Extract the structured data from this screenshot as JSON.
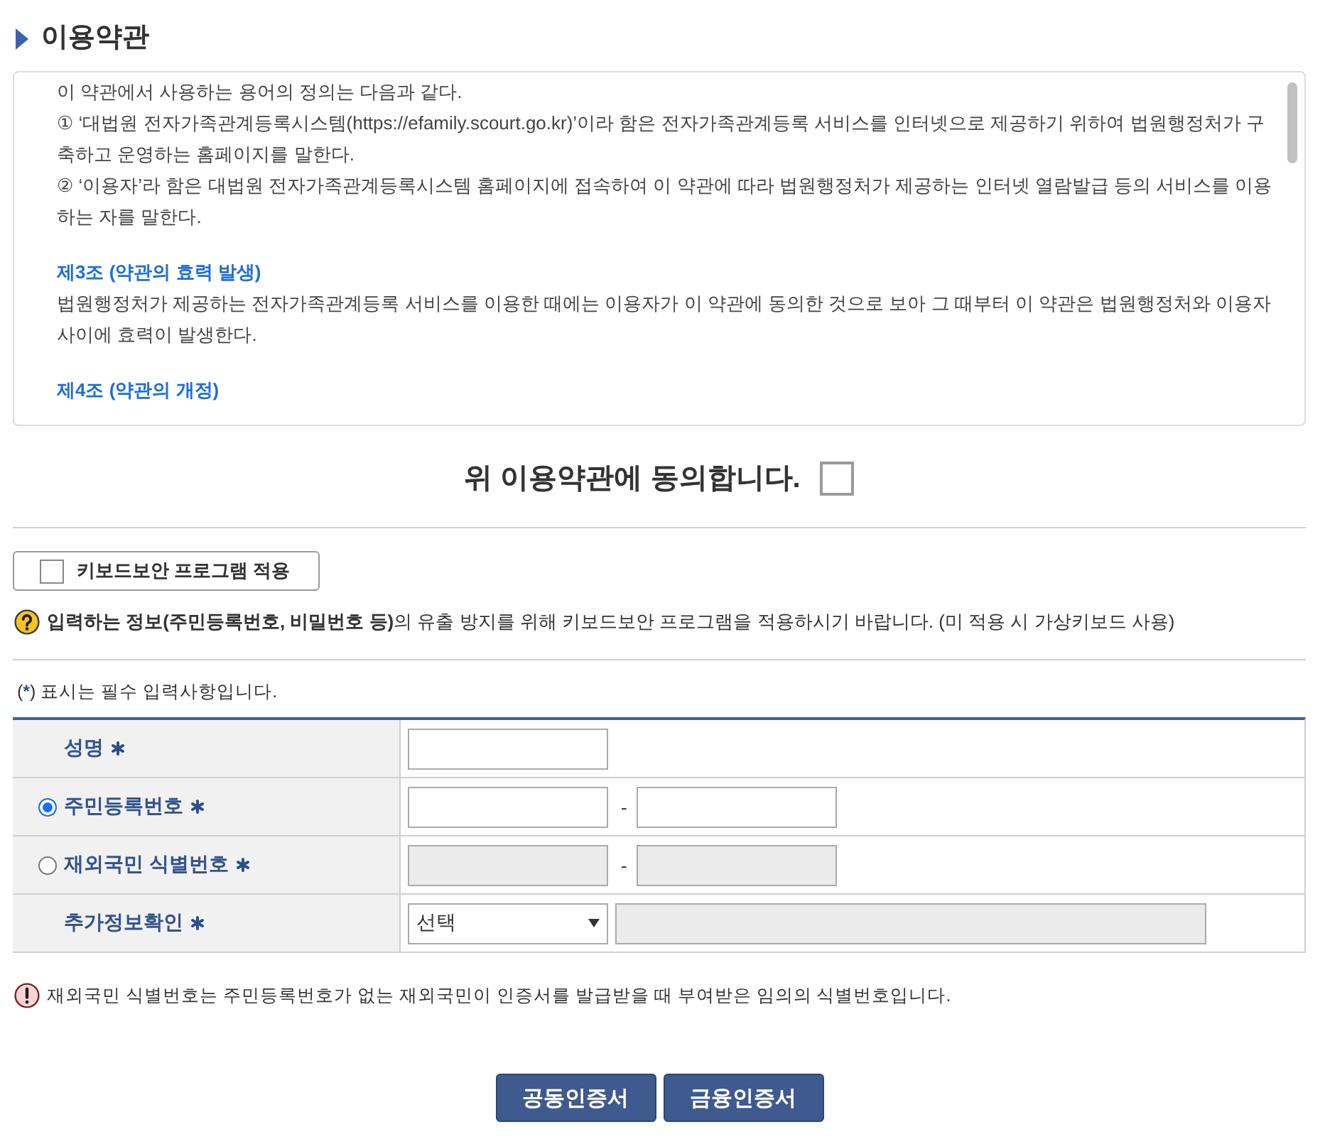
{
  "section": {
    "title": "이용약관"
  },
  "terms": {
    "paragraphs": [
      {
        "kind": "text",
        "text": "이 약관에서 사용하는 용어의 정의는 다음과 같다."
      },
      {
        "kind": "text",
        "text": "① ‘대법원 전자가족관계등록시스템(https://efamily.scourt.go.kr)’이라 함은 전자가족관계등록 서비스를 인터넷으로 제공하기 위하여 법원행정처가 구축하고 운영하는 홈페이지를 말한다."
      },
      {
        "kind": "text",
        "text": "② ‘이용자’라 함은 대법원 전자가족관계등록시스템 홈페이지에 접속하여 이 약관에 따라 법원행정처가 제공하는 인터넷 열람발급 등의 서비스를 이용하는 자를 말한다."
      },
      {
        "kind": "heading",
        "text": "제3조 (약관의 효력 발생)"
      },
      {
        "kind": "text",
        "text": "법원행정처가 제공하는 전자가족관계등록 서비스를 이용한 때에는 이용자가 이 약관에 동의한 것으로 보아 그 때부터 이 약관은 법원행정처와 이용자 사이에 효력이 발생한다."
      },
      {
        "kind": "heading",
        "text": "제4조 (약관의 개정)"
      }
    ]
  },
  "agree": {
    "label": "위 이용약관에 동의합니다.",
    "checked": false
  },
  "keyboard_security": {
    "label": "키보드보안 프로그램 적용",
    "checked": false
  },
  "keyboard_notice": "**입력하는 정보(주민등록번호, 비밀번호 등)**의 유출 방지를 위해 키보드보안 프로그램을 적용하시기 바랍니다. (미 적용 시 가상키보드 사용)",
  "required_note": {
    "open": "(",
    "mark": "*",
    "rest": ") 표시는 필수 입력사항입니다."
  },
  "form": {
    "rows": [
      {
        "kind": "plain",
        "label": "성명",
        "required": true,
        "fields": [
          {
            "kind": "input",
            "disabled": false
          }
        ]
      },
      {
        "kind": "radio",
        "label": "주민등록번호",
        "required": true,
        "selected": true,
        "fields": [
          {
            "kind": "input",
            "disabled": false
          },
          {
            "kind": "separator",
            "text": "-"
          },
          {
            "kind": "input",
            "disabled": false
          }
        ]
      },
      {
        "kind": "radio",
        "label": "재외국민 식별번호",
        "required": true,
        "selected": false,
        "fields": [
          {
            "kind": "input",
            "disabled": true
          },
          {
            "kind": "separator",
            "text": "-"
          },
          {
            "kind": "input",
            "disabled": true
          }
        ]
      },
      {
        "kind": "plain",
        "label": "추가정보확인",
        "required": true,
        "fields": [
          {
            "kind": "select",
            "value": "선택"
          },
          {
            "kind": "input",
            "disabled": true
          }
        ]
      }
    ]
  },
  "foreign_id_notice": "재외국민 식별번호는 주민등록번호가 없는 재외국민이 인증서를 발급받을 때 부여받은 임의의 식별번호입니다.",
  "buttons": [
    {
      "label": "공동인증서"
    },
    {
      "label": "금융인증서"
    }
  ]
}
